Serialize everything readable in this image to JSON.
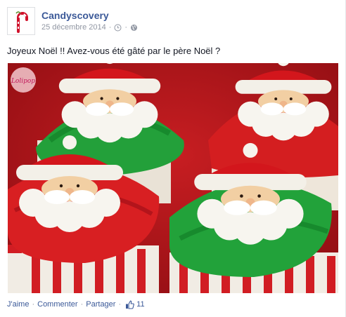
{
  "page": {
    "name": "Candyscovery",
    "date": "25 décembre 2014"
  },
  "icons": {
    "avatar": "candy-cane-logo",
    "clock": "clock-icon",
    "globe": "globe-icon",
    "thumb": "thumbs-up-icon"
  },
  "post": {
    "text": "Joyeux Noël !! Avez-vous été gâté par le père Noël ?",
    "photo_alt": "Cupcakes Père Noël"
  },
  "watermark": "Lolipop",
  "actions": {
    "like": "J'aime",
    "comment": "Commenter",
    "share": "Partager",
    "like_count": "11"
  },
  "colors": {
    "link": "#3b5998",
    "meta": "#9197a3",
    "text": "#141823"
  }
}
